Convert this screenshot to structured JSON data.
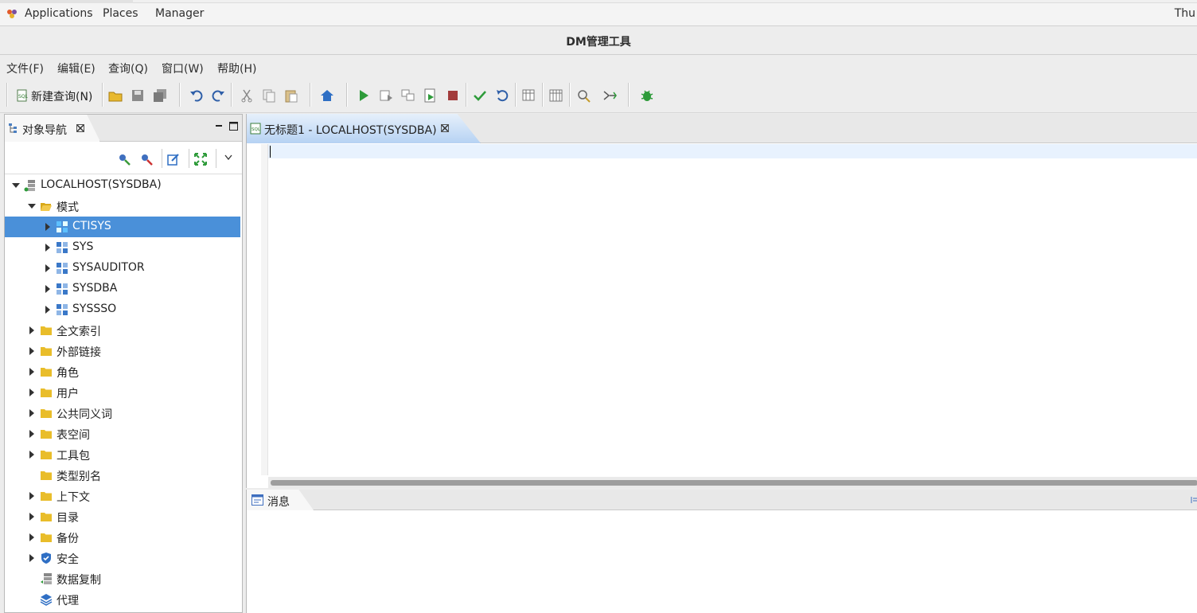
{
  "topbar": {
    "applications": "Applications",
    "places": "Places",
    "manager": "Manager",
    "clock": "Thu"
  },
  "window": {
    "title": "DM管理工具"
  },
  "menubar": {
    "file": "文件(F)",
    "edit": "编辑(E)",
    "query": "查询(Q)",
    "window": "窗口(W)",
    "help": "帮助(H)"
  },
  "toolbar": {
    "new_query": "新建查询(N)"
  },
  "nav": {
    "tab_label": "对象导航",
    "tree": [
      {
        "label": "LOCALHOST(SYSDBA)",
        "icon": "server-icon",
        "level": 0,
        "expand": "down"
      },
      {
        "label": "模式",
        "icon": "folder-open-icon",
        "level": 1,
        "expand": "down"
      },
      {
        "label": "CTISYS",
        "icon": "schema-icon",
        "level": 2,
        "expand": "right",
        "selected": true
      },
      {
        "label": "SYS",
        "icon": "schema-icon",
        "level": 2,
        "expand": "right"
      },
      {
        "label": "SYSAUDITOR",
        "icon": "schema-icon",
        "level": 2,
        "expand": "right"
      },
      {
        "label": "SYSDBA",
        "icon": "schema-icon",
        "level": 2,
        "expand": "right"
      },
      {
        "label": "SYSSSO",
        "icon": "schema-icon",
        "level": 2,
        "expand": "right"
      },
      {
        "label": "全文索引",
        "icon": "folder-icon",
        "level": 1,
        "expand": "right"
      },
      {
        "label": "外部链接",
        "icon": "folder-icon",
        "level": 1,
        "expand": "right"
      },
      {
        "label": "角色",
        "icon": "folder-icon",
        "level": 1,
        "expand": "right"
      },
      {
        "label": "用户",
        "icon": "folder-icon",
        "level": 1,
        "expand": "right"
      },
      {
        "label": "公共同义词",
        "icon": "folder-icon",
        "level": 1,
        "expand": "right"
      },
      {
        "label": "表空间",
        "icon": "folder-icon",
        "level": 1,
        "expand": "right"
      },
      {
        "label": "工具包",
        "icon": "folder-icon",
        "level": 1,
        "expand": "right"
      },
      {
        "label": "类型别名",
        "icon": "folder-icon",
        "level": 1,
        "expand": "none"
      },
      {
        "label": "上下文",
        "icon": "folder-icon",
        "level": 1,
        "expand": "right"
      },
      {
        "label": "目录",
        "icon": "folder-icon",
        "level": 1,
        "expand": "right"
      },
      {
        "label": "备份",
        "icon": "folder-icon",
        "level": 1,
        "expand": "right"
      },
      {
        "label": "安全",
        "icon": "shield-icon",
        "level": 1,
        "expand": "right"
      },
      {
        "label": "数据复制",
        "icon": "replication-icon",
        "level": 1,
        "expand": "none"
      },
      {
        "label": "代理",
        "icon": "agent-layers-icon",
        "level": 1,
        "expand": "none"
      }
    ]
  },
  "editor": {
    "tab_label": "无标题1 - LOCALHOST(SYSDBA)"
  },
  "messages": {
    "tab_label": "消息"
  }
}
